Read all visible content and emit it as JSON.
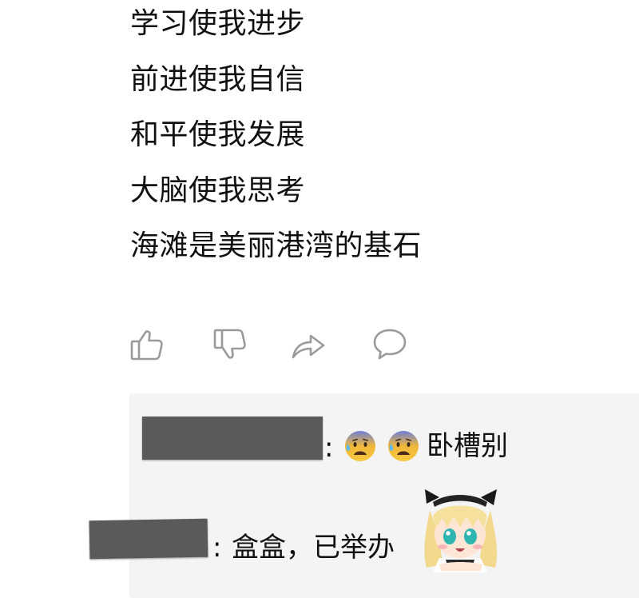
{
  "post": {
    "lines": [
      "学习使我进步",
      "前进使我自信",
      "和平使我发展",
      "大脑使我思考",
      "海滩是美丽港湾的基石"
    ]
  },
  "actions": [
    {
      "icon": "thumbs-up-icon"
    },
    {
      "icon": "thumbs-down-icon"
    },
    {
      "icon": "share-icon"
    },
    {
      "icon": "comment-icon"
    }
  ],
  "comments": [
    {
      "author_redacted": true,
      "separator": ":",
      "emojis": [
        "anxious-face-with-sweat-icon",
        "anxious-face-with-sweat-icon"
      ],
      "text": "卧槽别"
    },
    {
      "author_redacted": true,
      "separator": ":",
      "text": "盒盒，已举办",
      "sticker": "anime-girl-sticker"
    }
  ],
  "colors": {
    "background": "#ffffff",
    "comment_panel": "#f4f4f4",
    "icon_stroke": "#9a9a9a",
    "redaction": "#5a5a5a"
  }
}
